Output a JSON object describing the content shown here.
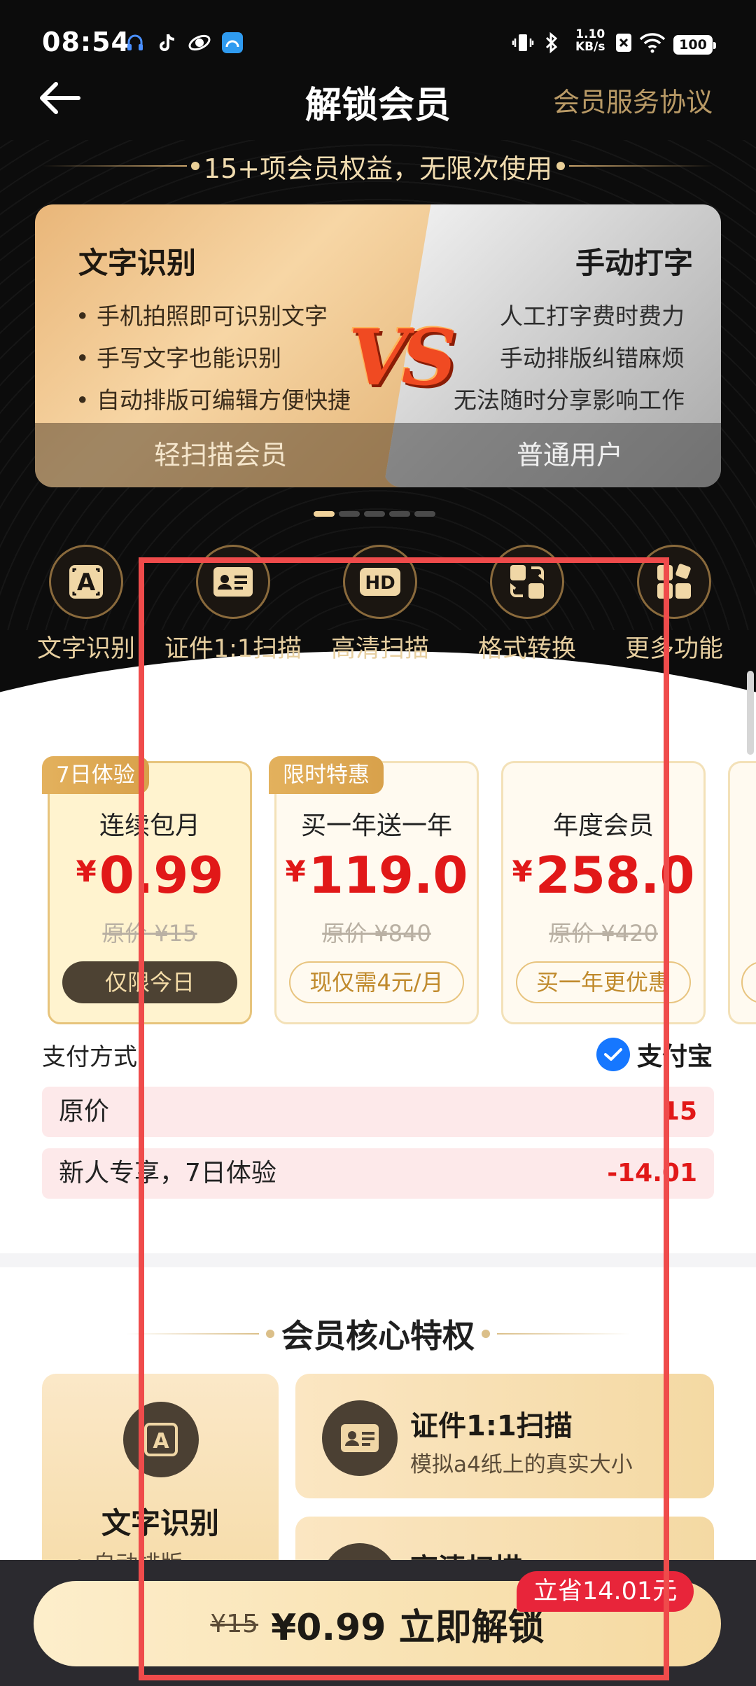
{
  "status": {
    "time": "08:54",
    "net_speed": "1.10",
    "net_unit": "KB/s",
    "battery": "100"
  },
  "nav": {
    "title": "解锁会员",
    "agreement": "会员服务协议"
  },
  "banner": {
    "benefit_text": "15+项会员权益，无限次使用"
  },
  "compare": {
    "left": {
      "title": "文字识别",
      "points": [
        "• 手机拍照即可识别文字",
        "• 手写文字也能识别",
        "• 自动排版可编辑方便快捷"
      ],
      "footer": "轻扫描会员"
    },
    "vs": "VS",
    "right": {
      "title": "手动打字",
      "points": [
        "人工打字费时费力",
        "手动排版纠错麻烦",
        "无法随时分享影响工作"
      ],
      "footer": "普通用户"
    }
  },
  "carousel": {
    "pages": 5,
    "active": 0
  },
  "functions": [
    {
      "label": "文字识别",
      "icon": "ocr-icon"
    },
    {
      "label": "证件1:1扫描",
      "icon": "id-card-icon"
    },
    {
      "label": "高清扫描",
      "icon": "hd-icon"
    },
    {
      "label": "格式转换",
      "icon": "convert-icon"
    },
    {
      "label": "更多功能",
      "icon": "more-icon"
    }
  ],
  "plans": [
    {
      "tag": "7日体验",
      "name": "连续包月",
      "currency": "¥",
      "price": "0.99",
      "original": "原价 ¥15",
      "pill": "仅限今日",
      "selected": true
    },
    {
      "tag": "限时特惠",
      "name": "买一年送一年",
      "currency": "¥",
      "price": "119.0",
      "original": "原价 ¥840",
      "pill": "现仅需4元/月",
      "selected": false
    },
    {
      "tag": "",
      "name": "年度会员",
      "currency": "¥",
      "price": "258.0",
      "original": "原价 ¥420",
      "pill": "买一年更优惠",
      "selected": false
    }
  ],
  "payment": {
    "label": "支付方式",
    "method": "支付宝"
  },
  "breakdown": [
    {
      "label": "原价",
      "value": "15"
    },
    {
      "label": "新人专享，7日体验",
      "value": "-14.01"
    }
  ],
  "core": {
    "title": "会员核心特权",
    "big": {
      "title": "文字识别",
      "sub": "• 自动排版"
    },
    "cards": [
      {
        "title": "证件1:1扫描",
        "sub": "模拟a4纸上的真实大小"
      },
      {
        "title": "高清扫描",
        "sub": ""
      }
    ]
  },
  "cta": {
    "old_price": "¥15",
    "label": "¥0.99 立即解锁",
    "save_badge": "立省14.01元"
  },
  "colors": {
    "gold": "#f1d39b",
    "red": "#e11818",
    "highlight": "#ef4b4b",
    "alipay": "#1677ff"
  }
}
